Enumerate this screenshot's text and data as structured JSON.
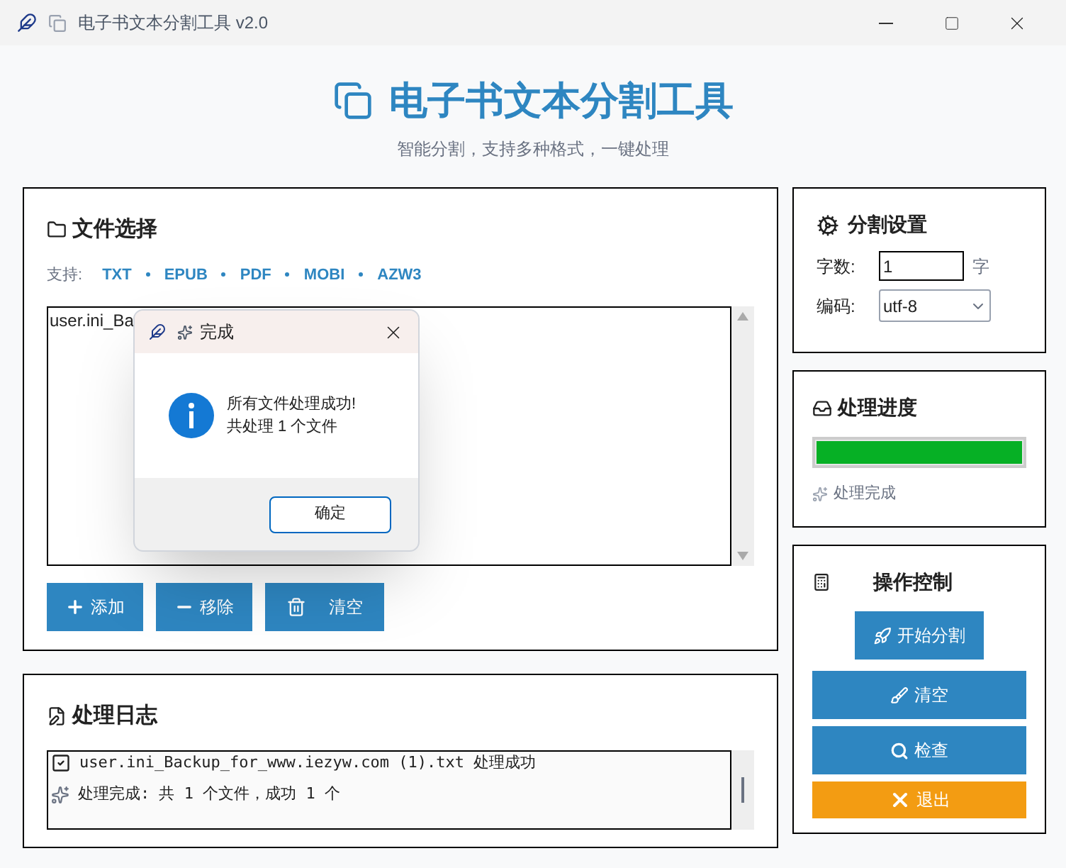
{
  "window": {
    "title": "电子书文本分割工具 v2.0"
  },
  "header": {
    "title": "电子书文本分割工具",
    "subtitle": "智能分割，支持多种格式，一键处理"
  },
  "file_panel": {
    "title": "文件选择",
    "formats_label": "支持:",
    "formats": [
      "TXT",
      "EPUB",
      "PDF",
      "MOBI",
      "AZW3"
    ],
    "files": [
      "user.ini_Ba"
    ],
    "buttons": [
      {
        "label": "添加",
        "kind": "add"
      },
      {
        "label": "移除",
        "kind": "remove"
      },
      {
        "label": "清空",
        "kind": "clear"
      }
    ]
  },
  "settings": {
    "title": "分割设置",
    "fields": [
      {
        "kind": "input",
        "label": "字数:",
        "value": "1",
        "unit": "字"
      },
      {
        "kind": "select",
        "label": "编码:",
        "value": "utf-8"
      }
    ]
  },
  "progress": {
    "title": "处理进度",
    "level": 1,
    "status": "处理完成"
  },
  "controls": {
    "title": "操作控制",
    "buttons": [
      {
        "label": "开始分割",
        "kind": "start"
      },
      {
        "label": "清空",
        "kind": "clear"
      },
      {
        "label": "检查",
        "kind": "check"
      },
      {
        "label": "退出",
        "kind": "exit"
      }
    ]
  },
  "log": {
    "title": "处理日志",
    "entries": [
      {
        "kind": "check",
        "text": "user.ini_Backup_for_www.iezyw.com (1).txt 处理成功"
      },
      {
        "kind": "sparkle",
        "text": "处理完成: 共 1 个文件，成功 1 个"
      }
    ]
  },
  "dialog": {
    "title": "完成",
    "lines": [
      "所有文件处理成功!",
      "共处理 1 个文件"
    ],
    "button": "确定"
  }
}
